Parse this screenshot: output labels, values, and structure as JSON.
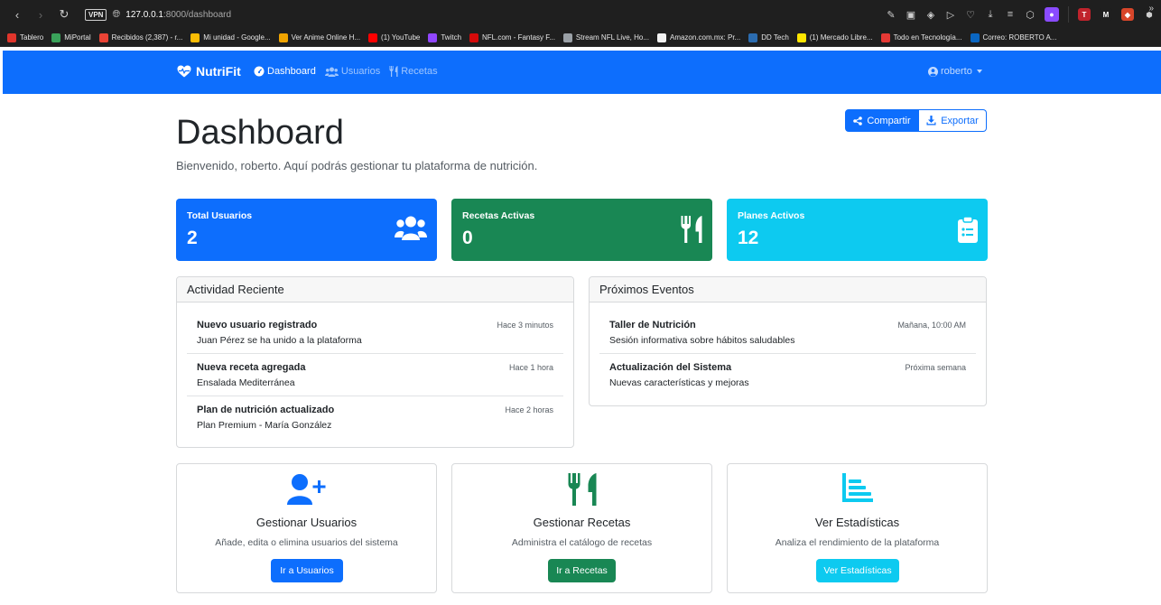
{
  "browser": {
    "vpn_badge": "VPN",
    "url_host": "127.0.0.1",
    "url_rest": ":8000/dashboard",
    "bookmarks": [
      {
        "label": "Tablero",
        "color": "#e0352b"
      },
      {
        "label": "MiPortal",
        "color": "#3aa25a"
      },
      {
        "label": "Recibidos (2,387) - r...",
        "color": "#ea4335"
      },
      {
        "label": "Mi unidad - Google...",
        "color": "#fbbc04"
      },
      {
        "label": "Ver Anime Online H...",
        "color": "#f0a400"
      },
      {
        "label": "(1) YouTube",
        "color": "#ff0000"
      },
      {
        "label": "Twitch",
        "color": "#9146ff"
      },
      {
        "label": "NFL.com - Fantasy F...",
        "color": "#d50a0a"
      },
      {
        "label": "Stream NFL Live, Ho...",
        "color": "#9aa0a6"
      },
      {
        "label": "Amazon.com.mx: Pr...",
        "color": "#f2f2f2"
      },
      {
        "label": "DD Tech",
        "color": "#2b6cb0"
      },
      {
        "label": "(1) Mercado Libre...",
        "color": "#ffe600"
      },
      {
        "label": "Todo en Tecnología...",
        "color": "#e53935"
      },
      {
        "label": "Correo: ROBERTO A...",
        "color": "#0a66c2"
      }
    ]
  },
  "navbar": {
    "brand": "NutriFit",
    "links": [
      {
        "label": "Dashboard",
        "icon": "gauge-icon",
        "active": true
      },
      {
        "label": "Usuarios",
        "icon": "users-icon",
        "active": false
      },
      {
        "label": "Recetas",
        "icon": "utensils-icon",
        "active": false
      }
    ],
    "user": "roberto"
  },
  "header": {
    "title": "Dashboard",
    "subtitle": "Bienvenido, roberto. Aquí podrás gestionar tu plataforma de nutrición.",
    "share_label": "Compartir",
    "export_label": "Exportar"
  },
  "stats": [
    {
      "title": "Total Usuarios",
      "value": "2",
      "color": "#0d6efd",
      "icon": "users-icon"
    },
    {
      "title": "Recetas Activas",
      "value": "0",
      "color": "#198754",
      "icon": "utensils-icon"
    },
    {
      "title": "Planes Activos",
      "value": "12",
      "color": "#0dcaf0",
      "icon": "clipboard-list-icon"
    }
  ],
  "activity": {
    "title": "Actividad Reciente",
    "items": [
      {
        "title": "Nuevo usuario registrado",
        "desc": "Juan Pérez se ha unido a la plataforma",
        "time": "Hace 3 minutos"
      },
      {
        "title": "Nueva receta agregada",
        "desc": "Ensalada Mediterránea",
        "time": "Hace 1 hora"
      },
      {
        "title": "Plan de nutrición actualizado",
        "desc": "Plan Premium - María González",
        "time": "Hace 2 horas"
      }
    ]
  },
  "events": {
    "title": "Próximos Eventos",
    "items": [
      {
        "title": "Taller de Nutrición",
        "desc": "Sesión informativa sobre hábitos saludables",
        "time": "Mañana, 10:00 AM"
      },
      {
        "title": "Actualización del Sistema",
        "desc": "Nuevas características y mejoras",
        "time": "Próxima semana"
      }
    ]
  },
  "actions": [
    {
      "title": "Gestionar Usuarios",
      "desc": "Añade, edita o elimina usuarios del sistema",
      "button": "Ir a Usuarios",
      "color": "#0d6efd",
      "icon": "user-plus-icon"
    },
    {
      "title": "Gestionar Recetas",
      "desc": "Administra el catálogo de recetas",
      "button": "Ir a Recetas",
      "color": "#198754",
      "icon": "utensils-icon"
    },
    {
      "title": "Ver Estadísticas",
      "desc": "Analiza el rendimiento de la plataforma",
      "button": "Ver Estadísticas",
      "color": "#0dcaf0",
      "icon": "chart-bar-icon"
    }
  ]
}
